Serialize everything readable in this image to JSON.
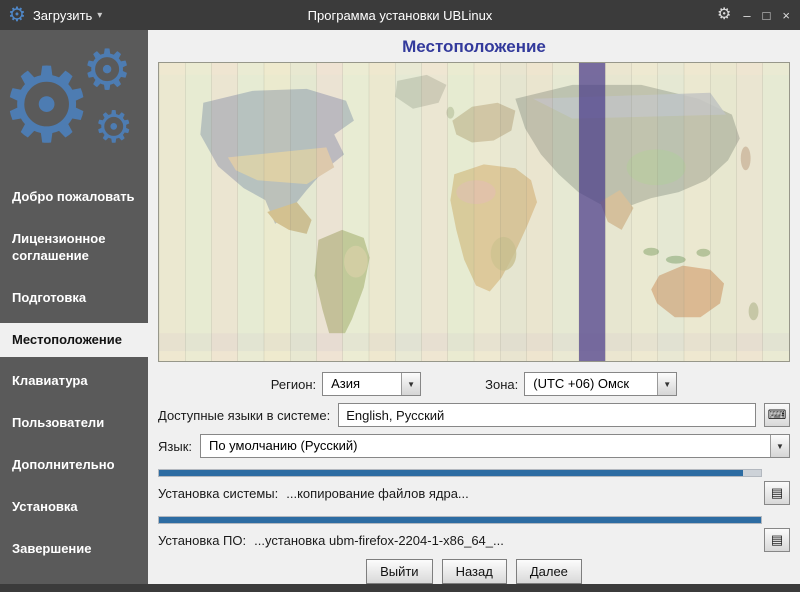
{
  "window": {
    "title": "Программа установки UBLinux",
    "load_label": "Загрузить"
  },
  "icons": {
    "gear": "⚙",
    "dropdown_arrow": "▾",
    "combo_arrow": "▼",
    "minimize": "–",
    "maximize": "□",
    "close": "×",
    "keyboard": "⌨",
    "log": "▤"
  },
  "sidebar": {
    "items": [
      {
        "label": "Добро пожаловать",
        "active": false
      },
      {
        "label": "Лицензионное соглашение",
        "active": false
      },
      {
        "label": "Подготовка",
        "active": false
      },
      {
        "label": "Местоположение",
        "active": true
      },
      {
        "label": "Клавиатура",
        "active": false
      },
      {
        "label": "Пользователи",
        "active": false
      },
      {
        "label": "Дополнительно",
        "active": false
      },
      {
        "label": "Установка",
        "active": false
      },
      {
        "label": "Завершение",
        "active": false
      }
    ]
  },
  "main": {
    "heading": "Местоположение",
    "region_label": "Регион:",
    "region_value": "Азия",
    "zone_label": "Зона:",
    "zone_value": "(UTC +06) Омск",
    "languages_label": "Доступные языки в системе:",
    "languages_value": "English, Русский",
    "language_label": "Язык:",
    "language_value": "По умолчанию (Русский)",
    "system_label": "Установка системы:",
    "system_status": "...копирование файлов ядра...",
    "system_progress": 97,
    "software_label": "Установка ПО:",
    "software_status": "...установка ubm-firefox-2204-1-x86_64_...",
    "software_progress": 100,
    "buttons": {
      "exit": "Выйти",
      "back": "Назад",
      "next": "Далее"
    }
  },
  "colors": {
    "progress": "#2d6ca2",
    "map_highlight": "#574a8e",
    "heading": "#333a9c",
    "sidebar_accent": "#4d7cb2"
  },
  "map": {
    "highlight_index": 16,
    "stripes": [
      "#e6d7bd",
      "#dce2c3",
      "#e8cfc0",
      "#d8e0c6",
      "#e8dfb6",
      "#d2d8c0",
      "#e6c9c6",
      "#dde3c6",
      "#e7d8b8",
      "#d4dcc8",
      "#e8d2c2",
      "#d9e0be",
      "#e6dcc0",
      "#d6cfbc",
      "#e4cfb8",
      "#d7dcc6",
      "#574a8e",
      "#dcd2bc",
      "#e3dabe",
      "#d3d8c6",
      "#e7d8bc",
      "#dbd3ba",
      "#e3cec0",
      "#d8ddc4"
    ]
  }
}
